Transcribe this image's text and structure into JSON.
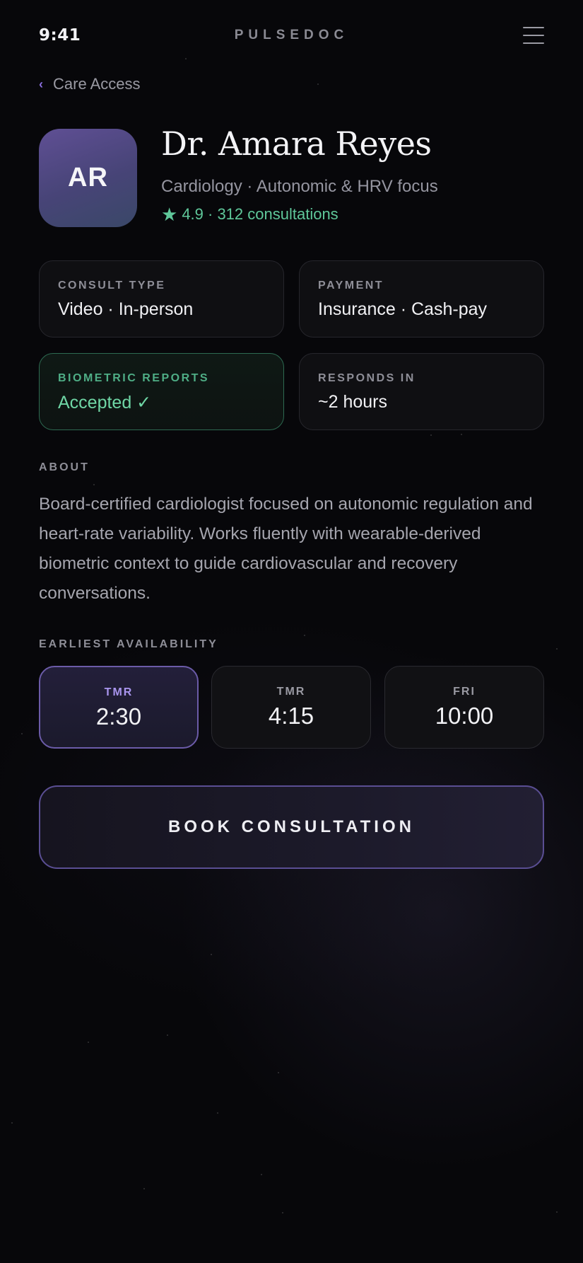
{
  "status_bar": {
    "time": "9:41",
    "brand": "PULSEDOC"
  },
  "nav": {
    "back_label": "Care Access"
  },
  "doctor": {
    "initials": "AR",
    "name": "Dr. Amara Reyes",
    "specialty": "Cardiology · Autonomic & HRV focus",
    "rating_text": "4.9 · 312 consultations"
  },
  "info_cards": [
    {
      "label": "CONSULT TYPE",
      "value": "Video · In-person"
    },
    {
      "label": "PAYMENT",
      "value": "Insurance · Cash-pay"
    },
    {
      "label": "BIOMETRIC REPORTS",
      "value": "Accepted ✓"
    },
    {
      "label": "RESPONDS IN",
      "value": "~2 hours"
    }
  ],
  "about": {
    "label": "ABOUT",
    "text": "Board-certified cardiologist focused on autonomic regulation and heart-rate variability. Works fluently with wearable-derived biometric context to guide cardiovascular and recovery conversations."
  },
  "availability": {
    "label": "EARLIEST AVAILABILITY",
    "slots": [
      {
        "day": "TMR",
        "time": "2:30",
        "selected": true
      },
      {
        "day": "TMR",
        "time": "4:15",
        "selected": false
      },
      {
        "day": "FRI",
        "time": "10:00",
        "selected": false
      }
    ]
  },
  "cta": {
    "book_label": "BOOK CONSULTATION"
  },
  "colors": {
    "accent_purple": "#6b5ba8",
    "accent_green": "#5fc79a",
    "background": "#07070a"
  },
  "icons": {
    "menu": "hamburger-menu-icon",
    "back": "chevron-left-icon",
    "rating": "star-icon"
  }
}
